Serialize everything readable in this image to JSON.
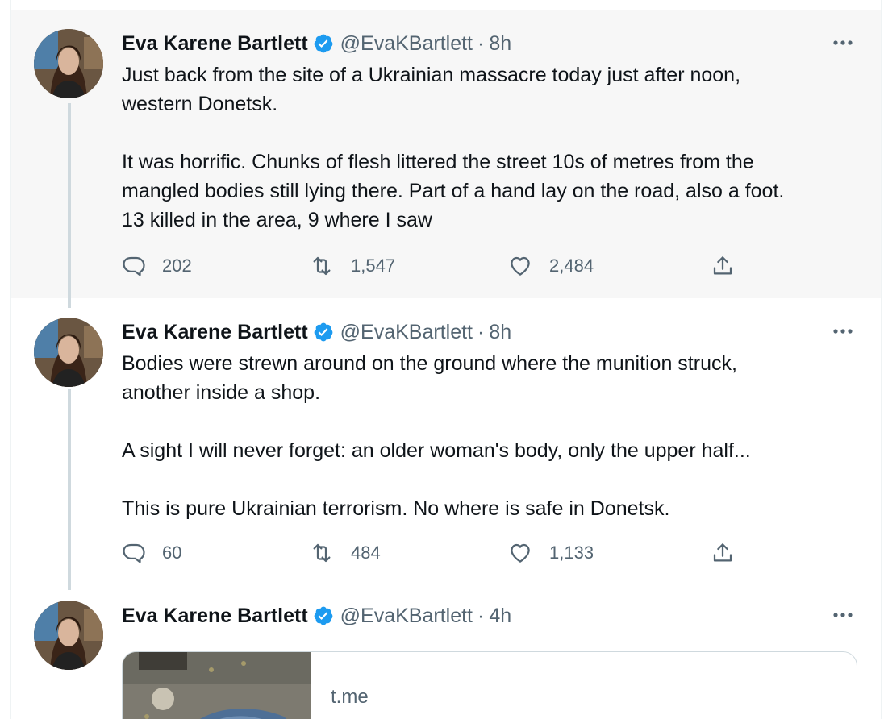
{
  "tweets": [
    {
      "author_name": "Eva Karene Bartlett",
      "handle": "@EvaKBartlett",
      "separator": "·",
      "time": "8h",
      "paragraphs": [
        "Just back from the site of a Ukrainian massacre today just after noon,\nwestern Donetsk.",
        "It was horrific. Chunks of flesh littered the street 10s of metres from the\nmangled bodies still lying there. Part of a hand lay on the road, also a foot.\n13 killed in the area, 9 where I saw"
      ],
      "replies": "202",
      "retweets": "1,547",
      "likes": "2,484"
    },
    {
      "author_name": "Eva Karene Bartlett",
      "handle": "@EvaKBartlett",
      "separator": "·",
      "time": "8h",
      "paragraphs": [
        "Bodies were strewn around on the ground where the munition struck,\nanother inside a shop.",
        "A sight I will never forget: an older woman's body, only the upper half...",
        "This is pure Ukrainian terrorism. No where is safe in Donetsk."
      ],
      "replies": "60",
      "retweets": "484",
      "likes": "1,133"
    },
    {
      "author_name": "Eva Karene Bartlett",
      "handle": "@EvaKBartlett",
      "separator": "·",
      "time": "4h",
      "card": {
        "domain": "t.me"
      }
    }
  ],
  "icons": {
    "verified": "verified-badge-icon",
    "more": "more-horizontal-icon",
    "reply": "reply-icon",
    "retweet": "retweet-icon",
    "like": "heart-icon",
    "share": "share-icon"
  },
  "colors": {
    "verified_blue": "#1d9bf0",
    "secondary_text": "#536471",
    "primary_text": "#0f1419",
    "highlight_bg": "#f7f7f7",
    "thread_line": "#cfd9de"
  }
}
